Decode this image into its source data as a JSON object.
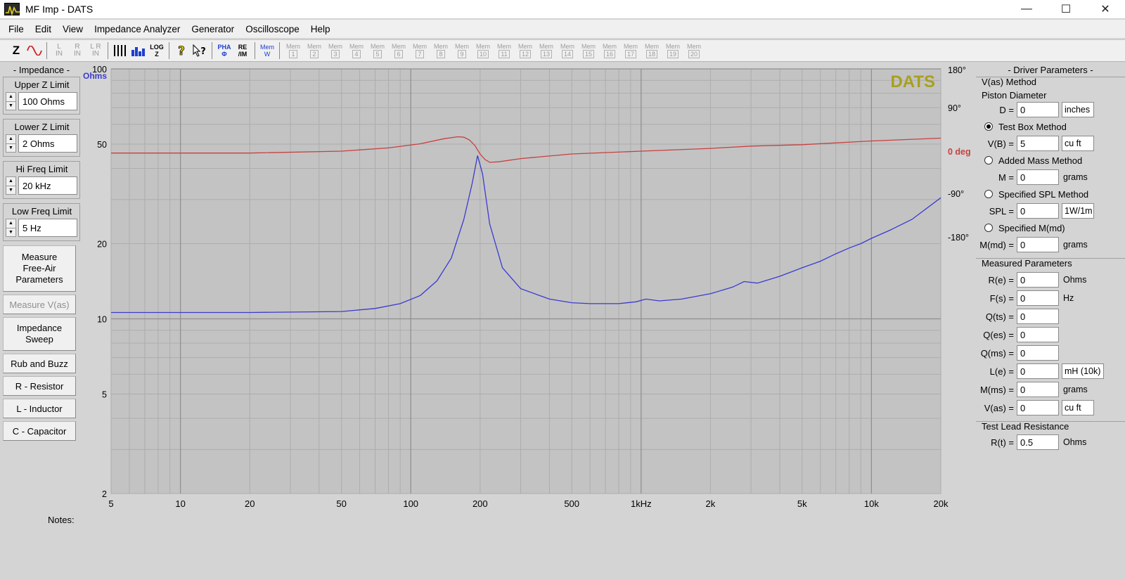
{
  "window": {
    "title": "MF Imp - DATS"
  },
  "menu": [
    "File",
    "Edit",
    "View",
    "Impedance Analyzer",
    "Generator",
    "Oscilloscope",
    "Help"
  ],
  "toolbar": {
    "z_label": "Z",
    "l_in": "L\nIN",
    "r_in": "R\nIN",
    "lr_in": "L R\nIN",
    "log_z": "LOG\nZ",
    "pha": "PHA\nΦ",
    "re_im": "RE\n/IM",
    "mem_w": "Mem\nW",
    "mem_prefix": "Mem",
    "mem_slots": [
      "1",
      "2",
      "3",
      "4",
      "5",
      "6",
      "7",
      "8",
      "9",
      "10",
      "11",
      "12",
      "13",
      "14",
      "15",
      "16",
      "17",
      "18",
      "19",
      "20"
    ]
  },
  "left_panel": {
    "title": "- Impedance -",
    "upper_z": {
      "label": "Upper Z Limit",
      "value": "100 Ohms"
    },
    "lower_z": {
      "label": "Lower Z Limit",
      "value": "2 Ohms"
    },
    "hi_freq": {
      "label": "Hi Freq Limit",
      "value": "20 kHz"
    },
    "low_freq": {
      "label": "Low Freq Limit",
      "value": "5 Hz"
    },
    "buttons": {
      "measure_free_air": "Measure Free-Air Parameters",
      "measure_vas": "Measure V(as)",
      "impedance_sweep": "Impedance Sweep",
      "rub_buzz": "Rub and Buzz",
      "resistor": "R - Resistor",
      "inductor": "L - Inductor",
      "capacitor": "C - Capacitor"
    }
  },
  "notes_label": "Notes:",
  "right_panel": {
    "title": "- Driver Parameters -",
    "vas_method": "V(as) Method",
    "piston_diameter": "Piston Diameter",
    "d": {
      "label": "D =",
      "value": "0",
      "unit": "inches"
    },
    "test_box": "Test Box Method",
    "vb": {
      "label": "V(B) =",
      "value": "5",
      "unit": "cu ft"
    },
    "added_mass": "Added Mass Method",
    "m": {
      "label": "M =",
      "value": "0",
      "unit": "grams"
    },
    "spl_method": "Specified SPL Method",
    "spl": {
      "label": "SPL =",
      "value": "0",
      "unit": "1W/1m"
    },
    "specified_mmd": "Specified M(md)",
    "mmd": {
      "label": "M(md) =",
      "value": "0",
      "unit": "grams"
    },
    "measured": "Measured Parameters",
    "params": [
      {
        "label": "R(e) =",
        "value": "0",
        "unit": "Ohms"
      },
      {
        "label": "F(s) =",
        "value": "0",
        "unit": "Hz"
      },
      {
        "label": "Q(ts) =",
        "value": "0",
        "unit": ""
      },
      {
        "label": "Q(es) =",
        "value": "0",
        "unit": ""
      },
      {
        "label": "Q(ms) =",
        "value": "0",
        "unit": ""
      },
      {
        "label": "L(e) =",
        "value": "0",
        "unit": "mH (10k)"
      },
      {
        "label": "M(ms) =",
        "value": "0",
        "unit": "grams"
      },
      {
        "label": "V(as) =",
        "value": "0",
        "unit": "cu ft"
      }
    ],
    "test_lead": "Test Lead Resistance",
    "rt": {
      "label": "R(t) =",
      "value": "0.5",
      "unit": "Ohms"
    }
  },
  "chart_data": {
    "type": "line",
    "watermark": "DATS",
    "x_scale": "log",
    "xlim": [
      5,
      20000
    ],
    "x_ticks": [
      5,
      10,
      20,
      50,
      100,
      200,
      500,
      1000,
      2000,
      5000,
      10000,
      20000
    ],
    "x_tick_labels": [
      "5",
      "10",
      "20",
      "50",
      "100",
      "200",
      "500",
      "1kHz",
      "2k",
      "5k",
      "10k",
      "20k"
    ],
    "y_scale": "log",
    "ylim": [
      2,
      100
    ],
    "y_ticks": [
      2,
      5,
      10,
      20,
      50,
      100
    ],
    "y_tick_labels": [
      "2",
      "5",
      "10",
      "20",
      "50",
      "100"
    ],
    "y_unit_label": "Ohms",
    "y2lim": [
      -180,
      180
    ],
    "y2_ticks": [
      180,
      90,
      0,
      -90,
      -180
    ],
    "y2_tick_labels": [
      "180°",
      "90°",
      "0 deg",
      "-90°",
      "-180°"
    ],
    "grid": true,
    "series": [
      {
        "name": "Impedance",
        "color": "#3b3bd0",
        "axis": "left",
        "x": [
          5,
          10,
          20,
          50,
          70,
          90,
          110,
          130,
          150,
          170,
          185,
          195,
          205,
          220,
          250,
          300,
          400,
          500,
          600,
          800,
          950,
          1050,
          1200,
          1500,
          2000,
          2500,
          2800,
          3200,
          4000,
          5000,
          6000,
          7000,
          8000,
          9000,
          10000,
          12000,
          15000,
          20000
        ],
        "y": [
          10.6,
          10.6,
          10.6,
          10.7,
          11.0,
          11.5,
          12.4,
          14.2,
          17.5,
          25,
          35,
          45,
          38,
          24,
          16,
          13.2,
          12.0,
          11.6,
          11.5,
          11.5,
          11.7,
          12.0,
          11.8,
          12.0,
          12.6,
          13.4,
          14.1,
          13.9,
          14.8,
          16.0,
          17.0,
          18.2,
          19.2,
          20.0,
          21.0,
          22.6,
          25.0,
          30.5
        ]
      },
      {
        "name": "Phase",
        "color": "#c84040",
        "axis": "right",
        "x": [
          5,
          10,
          20,
          50,
          80,
          110,
          140,
          160,
          170,
          180,
          190,
          200,
          210,
          220,
          240,
          300,
          500,
          1000,
          2000,
          3000,
          5000,
          10000,
          20000
        ],
        "y": [
          2,
          2,
          2,
          6,
          13,
          22,
          33,
          37,
          36,
          30,
          18,
          0,
          -12,
          -18,
          -17,
          -10,
          0,
          6,
          12,
          17,
          20,
          28,
          34
        ]
      }
    ]
  }
}
